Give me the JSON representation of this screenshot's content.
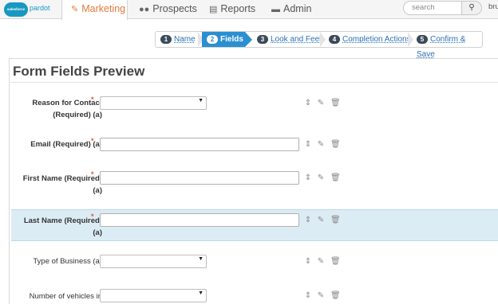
{
  "nav": {
    "logo": {
      "badge": "salesforce",
      "text": "pardot"
    },
    "items": [
      {
        "label": "Marketing",
        "icon": "pencil-icon",
        "active": true
      },
      {
        "label": "Prospects",
        "icon": "users-icon"
      },
      {
        "label": "Reports",
        "icon": "bar-chart-icon"
      },
      {
        "label": "Admin",
        "icon": "briefcase-icon"
      }
    ],
    "search_placeholder": "search",
    "user": "bru"
  },
  "wizard": {
    "steps": [
      {
        "num": "1",
        "label": "Name"
      },
      {
        "num": "2",
        "label": "Fields",
        "active": true
      },
      {
        "num": "3",
        "label": "Look and Feel"
      },
      {
        "num": "4",
        "label": "Completion Actions"
      },
      {
        "num": "5",
        "label": "Confirm & Save"
      }
    ]
  },
  "preview": {
    "title": "Form Fields Preview",
    "required_marker": "*",
    "fields": [
      {
        "label_line1": "Reason for Contact",
        "label_line2": "(Required) (a)",
        "type": "select",
        "required": true
      },
      {
        "label_line1": "Email (Required) (a)",
        "label_line2": "",
        "type": "text",
        "required": true
      },
      {
        "label_line1": "First Name (Required)",
        "label_line2": "(a)",
        "type": "text",
        "required": true
      },
      {
        "label_line1": "Last Name (Required)",
        "label_line2": "(a)",
        "type": "text",
        "required": true,
        "highlighted": true
      },
      {
        "label_line1": "Type of Business (a)",
        "label_line2": "",
        "type": "select",
        "required": false
      },
      {
        "label_line1": "Number of vehicles in",
        "label_line2": "",
        "type": "select",
        "required": false
      }
    ]
  },
  "colors": {
    "accent_orange": "#e4793a",
    "wizard_active": "#2a8fd1",
    "row_highlight": "#dcecf5",
    "required": "#e05a2b"
  }
}
